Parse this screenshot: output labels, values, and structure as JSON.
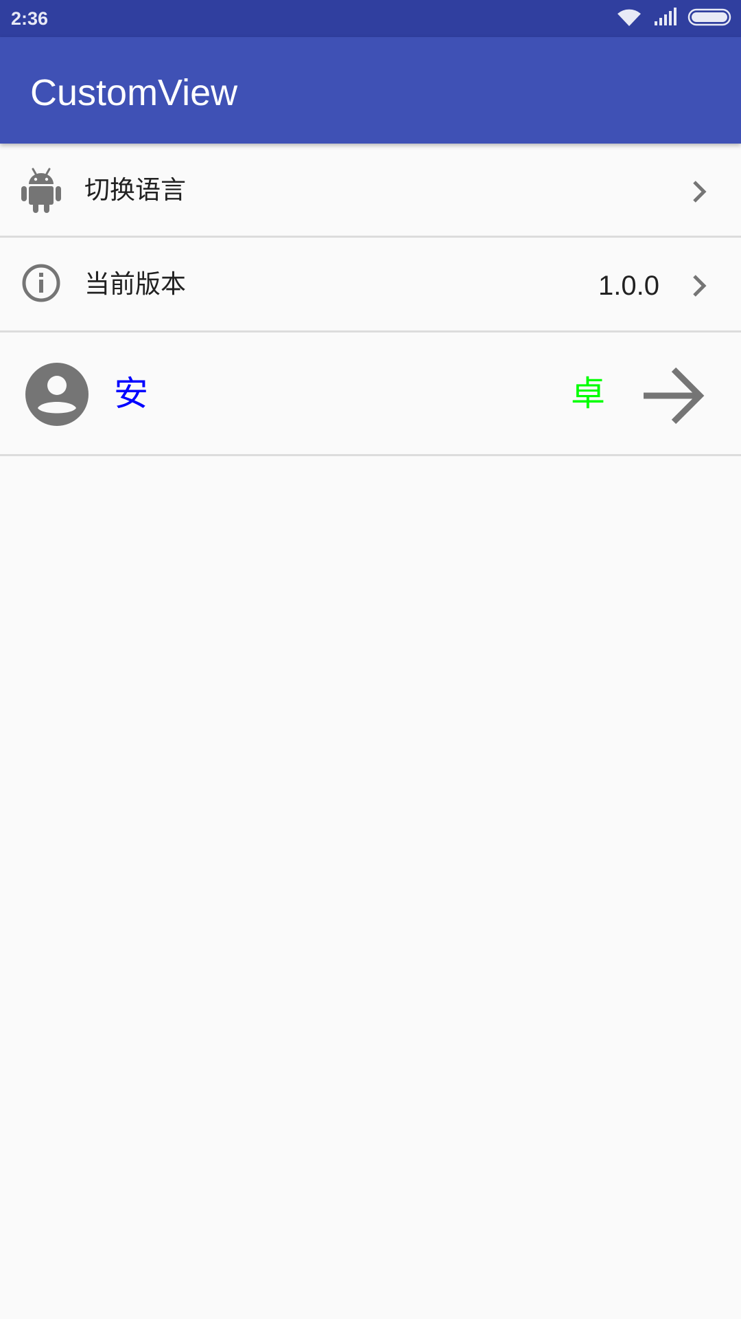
{
  "status_bar": {
    "time": "2:36",
    "icons": [
      "wifi-icon",
      "signal-icon",
      "battery-icon"
    ],
    "background": "#303f9f"
  },
  "app_bar": {
    "title": "CustomView",
    "background": "#3f51b5"
  },
  "rows": [
    {
      "icon": "android-icon",
      "label": "切换语言",
      "value": "",
      "trailing_icon": "chevron-right-icon"
    },
    {
      "icon": "info-icon",
      "label": "当前版本",
      "value": "1.0.0",
      "trailing_icon": "chevron-right-icon"
    },
    {
      "icon": "account-circle-icon",
      "label": "安",
      "label_color": "#0000ff",
      "value": "卓",
      "value_color": "#00ff00",
      "trailing_icon": "arrow-forward-icon"
    }
  ],
  "colors": {
    "icon_gray": "#757575",
    "divider": "#dcdcdc",
    "background": "#fafafa"
  }
}
